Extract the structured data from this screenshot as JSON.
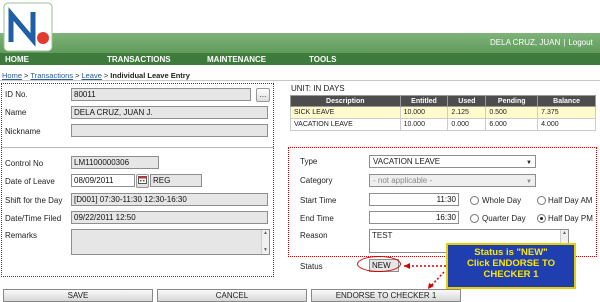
{
  "app": {
    "logo_letters": "N x",
    "user_name": "DELA CRUZ, JUAN",
    "logout_label": "Logout"
  },
  "nav": {
    "home": "HOME",
    "transactions": "TRANSACTIONS",
    "maintenance": "MAINTENANCE",
    "tools": "TOOLS"
  },
  "breadcrumb": {
    "home": "Home",
    "transactions": "Transactions",
    "leave": "Leave",
    "current": "Individual Leave Entry",
    "separator": ">"
  },
  "employee": {
    "id_label": "ID No.",
    "id_value": "80011",
    "lookup_button": "...",
    "name_label": "Name",
    "name_value": "DELA CRUZ, JUAN J.",
    "nickname_label": "Nickname",
    "nickname_value": ""
  },
  "leave_entry": {
    "control_no_label": "Control No",
    "control_no_value": "LM1100000306",
    "date_label": "Date of Leave",
    "date_value": "08/09/2011",
    "day_type": "REG",
    "shift_label": "Shift for the Day",
    "shift_value": "[D001] 07:30-11:30  12:30-16:30",
    "filed_label": "Date/Time Filed",
    "filed_value": "09/22/2011 12:50",
    "remarks_label": "Remarks",
    "remarks_value": ""
  },
  "units": {
    "title": "UNIT: IN DAYS",
    "headers": [
      "Description",
      "Entitled",
      "Used",
      "Pending",
      "Balance"
    ],
    "rows": [
      [
        "SICK LEAVE",
        "10.000",
        "2.125",
        "0.500",
        "7.375"
      ],
      [
        "VACATION LEAVE",
        "10.000",
        "0.000",
        "6.000",
        "4.000"
      ]
    ]
  },
  "details": {
    "type_label": "Type",
    "type_value": "VACATION LEAVE",
    "category_label": "Category",
    "category_value": "- not applicable -",
    "start_label": "Start Time",
    "start_value": "11:30",
    "end_label": "End Time",
    "end_value": "16:30",
    "whole_day": "Whole Day",
    "half_day_am": "Half Day AM",
    "quarter_day": "Quarter Day",
    "half_day_pm": "Half Day PM",
    "reason_label": "Reason",
    "reason_value": "TEST",
    "status_label": "Status",
    "status_value": "NEW",
    "selected_duration": "Half Day PM"
  },
  "buttons": {
    "save": "SAVE",
    "cancel": "CANCEL",
    "endorse": "ENDORSE TO CHECKER 1"
  },
  "callout": {
    "line1": "Status is \"NEW\"",
    "line2": "Click ENDORSE TO",
    "line3": "CHECKER 1"
  },
  "colors": {
    "brand_green": "#4f8f4b",
    "annotation_red": "#d40000",
    "callout_blue": "#1f3fb0",
    "callout_text": "#ffe800"
  }
}
